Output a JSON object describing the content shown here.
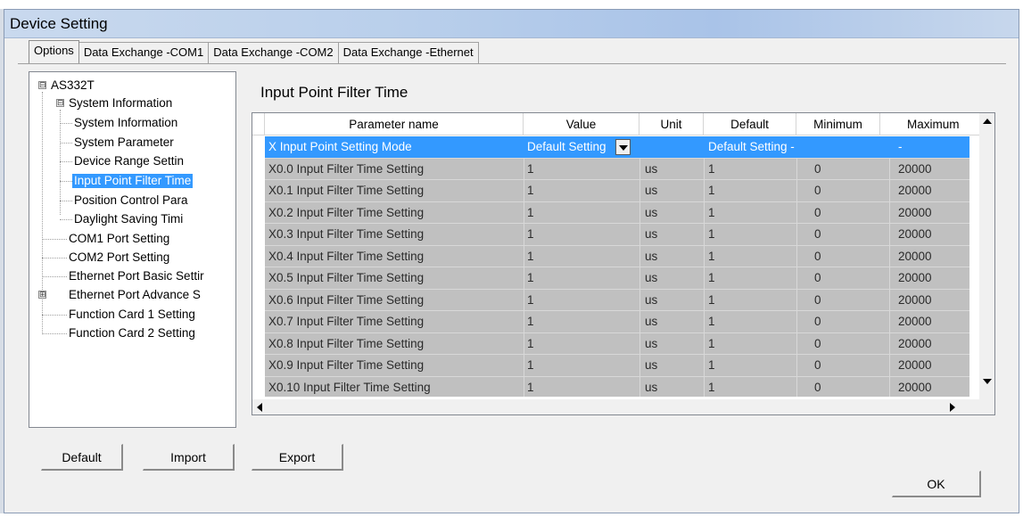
{
  "window": {
    "title": "Device Setting"
  },
  "tabs": [
    {
      "label": "Options",
      "active": true
    },
    {
      "label": "Data Exchange -COM1",
      "active": false
    },
    {
      "label": "Data Exchange -COM2",
      "active": false
    },
    {
      "label": "Data Exchange -Ethernet",
      "active": false
    }
  ],
  "tree": {
    "items": [
      {
        "label": "AS332T",
        "expander": "⊟"
      },
      {
        "label": "System Information",
        "expander": "⊟"
      },
      {
        "label": "System Information"
      },
      {
        "label": "System Parameter"
      },
      {
        "label": "Device Range Settin"
      },
      {
        "label": "Input Point Filter Time",
        "selected": true
      },
      {
        "label": "Position Control Para"
      },
      {
        "label": "Daylight Saving Timi"
      },
      {
        "label": "COM1 Port Setting"
      },
      {
        "label": "COM2 Port Setting"
      },
      {
        "label": "Ethernet Port Basic Settir"
      },
      {
        "label": "Ethernet Port Advance S",
        "expander": "⊞"
      },
      {
        "label": "Function Card 1 Setting"
      },
      {
        "label": "Function Card 2 Setting"
      }
    ]
  },
  "section_title": "Input Point Filter Time",
  "grid": {
    "columns": [
      "Parameter name",
      "Value",
      "Unit",
      "Default",
      "Minimum",
      "Maximum"
    ],
    "rows": [
      {
        "name": "X Input Point Setting Mode",
        "value": "Default Setting",
        "unit": "",
        "default": "Default Setting -",
        "minimum": "",
        "maximum": "-",
        "highlighted": true,
        "dropdown": true
      },
      {
        "name": "X0.0 Input Filter Time Setting",
        "value": "1",
        "unit": "us",
        "default": "1",
        "minimum": "0",
        "maximum": "20000"
      },
      {
        "name": "X0.1 Input Filter Time Setting",
        "value": "1",
        "unit": "us",
        "default": "1",
        "minimum": "0",
        "maximum": "20000"
      },
      {
        "name": "X0.2 Input Filter Time Setting",
        "value": "1",
        "unit": "us",
        "default": "1",
        "minimum": "0",
        "maximum": "20000"
      },
      {
        "name": "X0.3 Input Filter Time Setting",
        "value": "1",
        "unit": "us",
        "default": "1",
        "minimum": "0",
        "maximum": "20000"
      },
      {
        "name": "X0.4 Input Filter Time Setting",
        "value": "1",
        "unit": "us",
        "default": "1",
        "minimum": "0",
        "maximum": "20000"
      },
      {
        "name": "X0.5 Input Filter Time Setting",
        "value": "1",
        "unit": "us",
        "default": "1",
        "minimum": "0",
        "maximum": "20000"
      },
      {
        "name": "X0.6 Input Filter Time Setting",
        "value": "1",
        "unit": "us",
        "default": "1",
        "minimum": "0",
        "maximum": "20000"
      },
      {
        "name": "X0.7 Input Filter Time Setting",
        "value": "1",
        "unit": "us",
        "default": "1",
        "minimum": "0",
        "maximum": "20000"
      },
      {
        "name": "X0.8 Input Filter Time Setting",
        "value": "1",
        "unit": "us",
        "default": "1",
        "minimum": "0",
        "maximum": "20000"
      },
      {
        "name": "X0.9 Input Filter Time Setting",
        "value": "1",
        "unit": "us",
        "default": "1",
        "minimum": "0",
        "maximum": "20000"
      },
      {
        "name": "X0.10 Input Filter Time Setting",
        "value": "1",
        "unit": "us",
        "default": "1",
        "minimum": "0",
        "maximum": "20000"
      }
    ]
  },
  "buttons": {
    "default": "Default",
    "import": "Import",
    "export": "Export",
    "ok": "OK"
  },
  "colors": {
    "selection": "#3399ff",
    "row_fill": "#c0c0c0",
    "window_bg": "#f0f0f0"
  }
}
